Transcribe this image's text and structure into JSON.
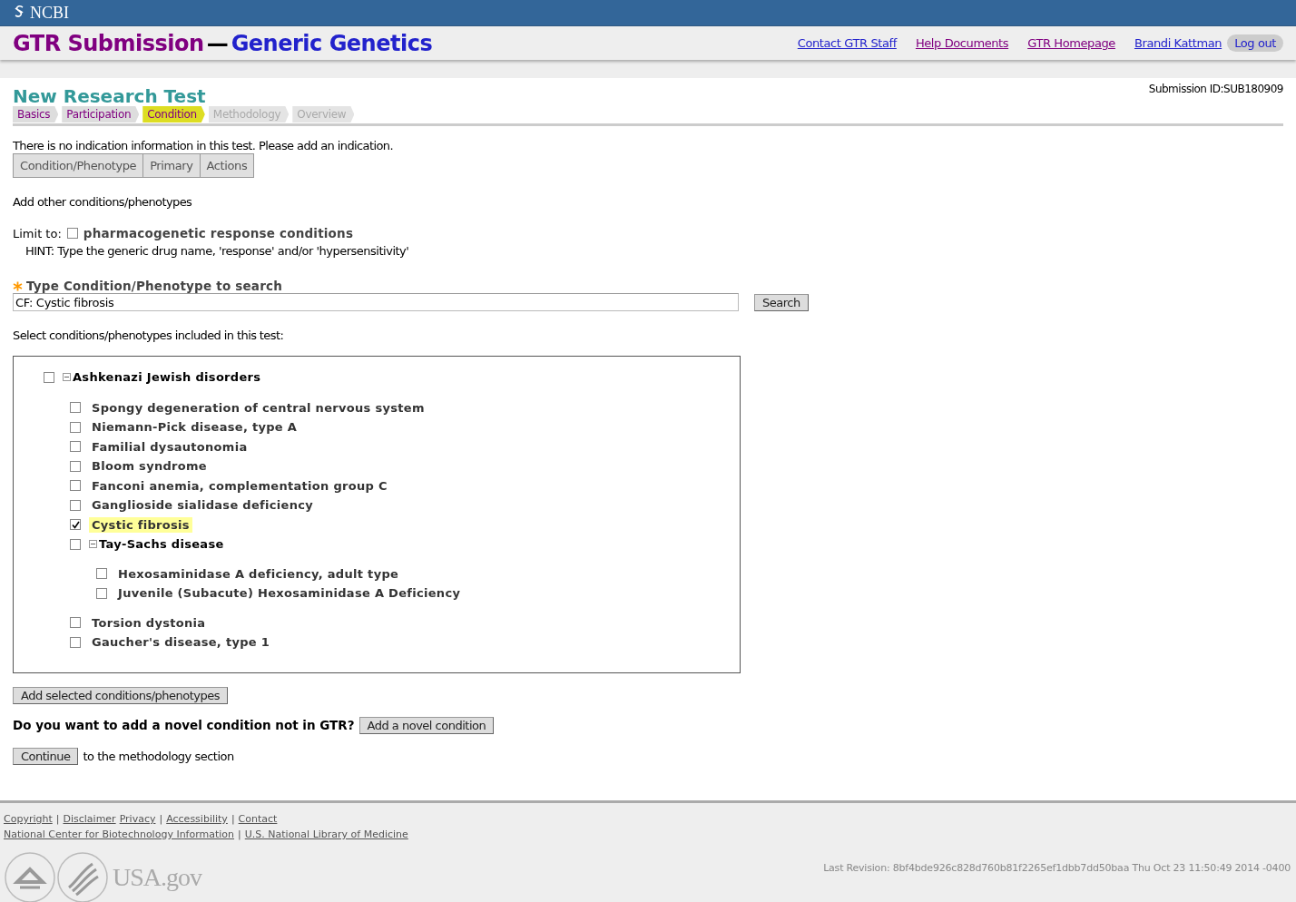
{
  "ncbi_bar": {
    "label": "NCBI"
  },
  "header": {
    "title": "GTR Submission",
    "dash": "—",
    "organization": "Generic Genetics",
    "links": [
      {
        "label": "Contact GTR Staff",
        "visited": false
      },
      {
        "label": "Help Documents",
        "visited": true
      },
      {
        "label": "GTR Homepage",
        "visited": true
      },
      {
        "label": "Brandi Kattman",
        "visited": false
      }
    ],
    "logout": "Log out"
  },
  "page": {
    "title": "New Research Test",
    "submission_id": "Submission ID:SUB180909",
    "steps": [
      {
        "label": "Basics",
        "selected": false,
        "disabled": false
      },
      {
        "label": "Participation",
        "selected": false,
        "disabled": false
      },
      {
        "label": "Condition",
        "selected": true,
        "disabled": false
      },
      {
        "label": "Methodology",
        "selected": false,
        "disabled": true
      },
      {
        "label": "Overview",
        "selected": false,
        "disabled": true
      }
    ],
    "notice": "There is no indication information in this test. Please add an indication.",
    "indication_table": {
      "columns": [
        "Condition/Phenotype",
        "Primary",
        "Actions"
      ]
    },
    "add_heading": "Add other conditions/phenotypes",
    "limit": {
      "label": "Limit to:",
      "option": {
        "label": "pharmacogenetic response conditions",
        "checked": false
      }
    },
    "hint": "HINT: Type the generic drug name, 'response' and/or 'hypersensitivity'",
    "search": {
      "required": true,
      "label": "Type Condition/Phenotype to search",
      "value": "CF: Cystic fibrosis",
      "button": "Search"
    },
    "select_label": "Select conditions/phenotypes included in this test:",
    "tree": [
      {
        "label": "Ashkenazi Jewish disorders",
        "checked": false,
        "selected": false,
        "expanded": true,
        "children": [
          {
            "label": "Spongy degeneration of central nervous system",
            "checked": false,
            "selected": false
          },
          {
            "label": "Niemann-Pick disease, type A",
            "checked": false,
            "selected": false
          },
          {
            "label": "Familial dysautonomia",
            "checked": false,
            "selected": false
          },
          {
            "label": "Bloom syndrome",
            "checked": false,
            "selected": false
          },
          {
            "label": "Fanconi anemia, complementation group C",
            "checked": false,
            "selected": false
          },
          {
            "label": "Ganglioside sialidase deficiency",
            "checked": false,
            "selected": false
          },
          {
            "label": "Cystic fibrosis",
            "checked": true,
            "selected": true
          },
          {
            "label": "Tay-Sachs disease",
            "checked": false,
            "selected": false,
            "expanded": true,
            "children": [
              {
                "label": "Hexosaminidase A deficiency, adult type",
                "checked": false,
                "selected": false
              },
              {
                "label": "Juvenile (Subacute) Hexosaminidase A Deficiency",
                "checked": false,
                "selected": false
              }
            ]
          },
          {
            "label": "Torsion dystonia",
            "checked": false,
            "selected": false
          },
          {
            "label": "Gaucher's disease, type 1",
            "checked": false,
            "selected": false
          }
        ]
      }
    ],
    "add_button": "Add selected conditions/phenotypes",
    "novel": {
      "question": "Do you want to add a novel condition not in GTR?",
      "button": "Add a novel condition"
    },
    "continue": {
      "button": "Continue",
      "text": "to the methodology section"
    }
  },
  "footer": {
    "link_rows": [
      [
        {
          "kind": "link",
          "text": "Copyright"
        },
        {
          "kind": "sep",
          "text": "|"
        },
        {
          "kind": "link",
          "text": "Disclaimer"
        },
        {
          "kind": "link",
          "text": "Privacy"
        },
        {
          "kind": "sep",
          "text": "|"
        },
        {
          "kind": "link",
          "text": "Accessibility"
        },
        {
          "kind": "sep",
          "text": "|"
        },
        {
          "kind": "link",
          "text": "Contact"
        }
      ],
      [
        {
          "kind": "link",
          "text": "National Center for Biotechnology Information"
        },
        {
          "kind": "sep",
          "text": "|"
        },
        {
          "kind": "link",
          "text": "U.S. National Library of Medicine"
        }
      ]
    ],
    "usa_gov": "USA.gov",
    "revision": "Last Revision: 8bf4bde926c828d760b81f2265ef1dbb7dd50baa Thu Oct 23 11:50:49 2014 -0400"
  }
}
